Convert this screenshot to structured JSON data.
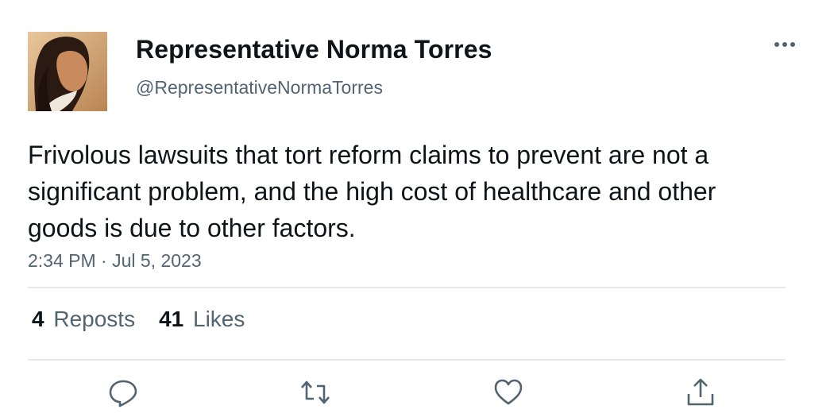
{
  "author": {
    "display_name": "Representative Norma Torres",
    "handle": "@RepresentativeNormaTorres"
  },
  "tweet": {
    "text": "Frivolous lawsuits that tort reform claims to prevent are not a significant problem, and the high cost of healthcare and other goods is due to other factors.",
    "timestamp": "2:34 PM · Jul 5, 2023"
  },
  "stats": {
    "reposts_count": "4",
    "reposts_label": "Reposts",
    "likes_count": "41",
    "likes_label": "Likes"
  },
  "icons": {
    "more": "more-options-icon",
    "reply": "reply-icon",
    "repost": "repost-icon",
    "like": "heart-icon",
    "share": "share-icon"
  },
  "colors": {
    "primary_text": "#0f1419",
    "secondary_text": "#536471",
    "divider": "#e6e9eb"
  }
}
